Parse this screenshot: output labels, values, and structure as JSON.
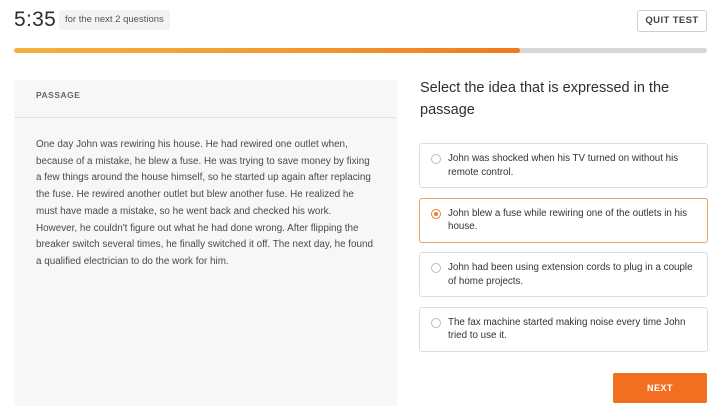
{
  "header": {
    "timer": "5:35",
    "timer_note": "for the next 2 questions",
    "quit_label": "QUIT TEST",
    "progress_fraction": 0.73
  },
  "passage": {
    "heading": "PASSAGE",
    "text": "One day John was rewiring his house. He had rewired one outlet when, because of a mistake, he blew a fuse. He was trying to save money by fixing a few things around the house himself, so he started up again after replacing the fuse. He rewired another outlet but blew another fuse. He realized he must have made a mistake, so he went back and checked his work. However, he couldn't figure out what he had done wrong. After flipping the breaker switch several times, he finally switched it off. The next day, he found a qualified electrician to do the work for him."
  },
  "question": {
    "prompt": "Select the idea that is expressed in the passage",
    "options": [
      {
        "label": "John was shocked when his TV turned on without his remote control.",
        "selected": false
      },
      {
        "label": "John blew a fuse while rewiring one of the outlets in his house.",
        "selected": true
      },
      {
        "label": "John had been using extension cords to plug in a couple of home projects.",
        "selected": false
      },
      {
        "label": "The fax machine started making noise every time John tried to use it.",
        "selected": false
      }
    ]
  },
  "footer": {
    "next_label": "NEXT"
  },
  "colors": {
    "accent": "#f36f21",
    "selected_border": "#f0a05a",
    "panel_bg": "#f7f7f7"
  }
}
